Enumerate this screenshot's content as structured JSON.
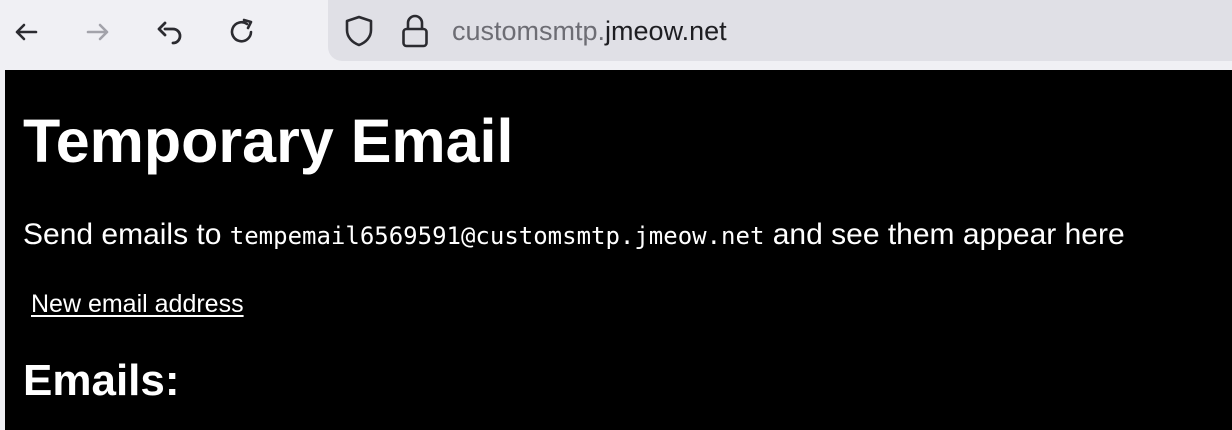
{
  "browser": {
    "icons": {
      "back": "back-arrow-icon",
      "forward": "forward-arrow-icon",
      "undo": "undo-icon",
      "reload": "reload-icon",
      "shield": "shield-icon",
      "lock": "lock-icon"
    },
    "url": {
      "subdomain": "customsmtp.",
      "domain": "jmeow.net"
    }
  },
  "page": {
    "title": "Temporary Email",
    "intro_prefix": "Send emails to ",
    "address": "tempemail6569591@customsmtp.jmeow.net",
    "intro_suffix": " and see them appear here",
    "new_address_link": "New email address",
    "emails_heading": "Emails:"
  },
  "colors": {
    "toolbar_bg": "#f0f0f4",
    "urlbar_bg": "#e0e0e6",
    "page_bg": "#000000",
    "page_text": "#ffffff"
  }
}
